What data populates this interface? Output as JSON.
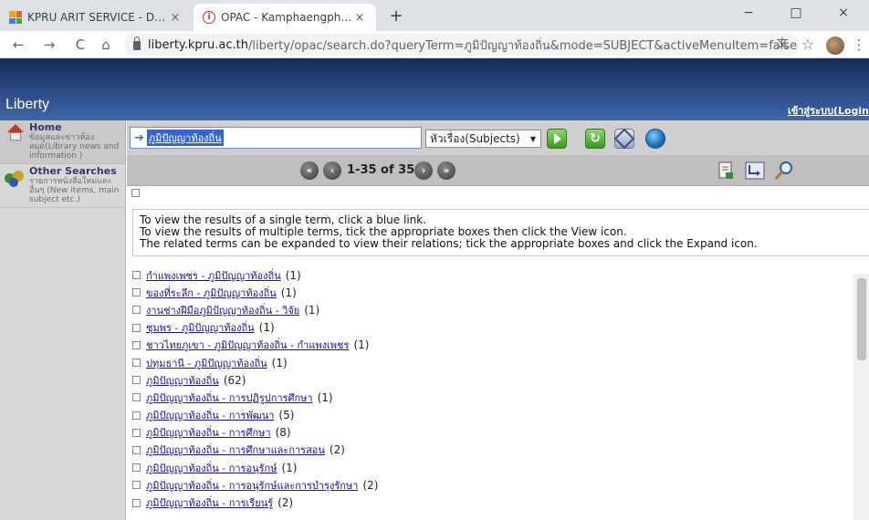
{
  "browser": {
    "tabs": [
      {
        "title": "KPRU ARIT SERVICE - Desktop",
        "close": "×"
      },
      {
        "title": "OPAC - Kamphaengphet Rajabha",
        "close": "×"
      }
    ],
    "new_tab": "+",
    "window_controls": {
      "minimize": "−",
      "maximize": "□",
      "close": "×"
    },
    "nav": {
      "back": "←",
      "forward": "→",
      "reload": "C",
      "home": "⌂"
    },
    "url": {
      "host": "liberty.kpru.ac.th",
      "path": "/liberty/opac/search.do?queryTerm=ภูมิปัญญาท้องถิ่น&mode=SUBJECT&activeMenuItem=false"
    },
    "ext_icons": {
      "translate": "文",
      "star": "☆",
      "menu": "⋮"
    }
  },
  "header": {
    "logo": "Liberty",
    "login": "เข้าสู่ระบบ(Login"
  },
  "sidebar": {
    "items": [
      {
        "title": "Home",
        "desc": "ข้อมูลและข่าวห้องสมุด(Library news and information )"
      },
      {
        "title": "Other Searches",
        "desc": "รายการหนังสือใหม่และอื่นๆ (New items, main subject etc.)"
      }
    ]
  },
  "search": {
    "term": "ภูมิปัญญาท้องถิ่น",
    "type": "หัวเรื่อง(Subjects)"
  },
  "pager": {
    "first": "«",
    "prev": "‹",
    "label": "1-35 of 35",
    "next": "›",
    "last": "»"
  },
  "instructions": {
    "line1": "To view the results of a single term, click a blue link.",
    "line2": "To view the results of multiple terms, tick the appropriate boxes then click the View icon.",
    "line3": "The related terms can be expanded to view their relations; tick the appropriate boxes and click the Expand icon."
  },
  "results": [
    {
      "term": "กำแพงเพชร - ภูมิปัญญาท้องถิ่น",
      "count": "(1)"
    },
    {
      "term": "ของที่ระลึก - ภูมิปัญญาท้องถิ่น",
      "count": "(1)"
    },
    {
      "term": "งานช่างฝีมือภูมิปัญญาท้องถิ่น - วิจัย",
      "count": "(1)"
    },
    {
      "term": "ชุมพร - ภูมิปัญญาท้องถิ่น",
      "count": "(1)"
    },
    {
      "term": "ชาวไทยภูเขา - ภูมิปัญญาท้องถิ่น - กำแพงเพชร",
      "count": "(1)"
    },
    {
      "term": "ปทุมธานี - ภูมิปัญญาท้องถิ่น",
      "count": "(1)"
    },
    {
      "term": "ภูมิปัญญาท้องถิ่น",
      "count": "(62)"
    },
    {
      "term": "ภูมิปัญญาท้องถิ่น - การปฏิรูปการศึกษา",
      "count": "(1)"
    },
    {
      "term": "ภูมิปัญญาท้องถิ่น - การพัฒนา",
      "count": "(5)"
    },
    {
      "term": "ภูมิปัญญาท้องถิ่น - การศึกษา",
      "count": "(8)"
    },
    {
      "term": "ภูมิปัญญาท้องถิ่น - การศึกษาและการสอน",
      "count": "(2)"
    },
    {
      "term": "ภูมิปัญญาท้องถิ่น - การอนุรักษ์",
      "count": "(1)"
    },
    {
      "term": "ภูมิปัญญาท้องถิ่น - การอนุรักษ์และการบำรุงรักษา",
      "count": "(2)"
    },
    {
      "term": "ภูมิปัญญาท้องถิ่น - การเรียนรู้",
      "count": "(2)"
    }
  ]
}
